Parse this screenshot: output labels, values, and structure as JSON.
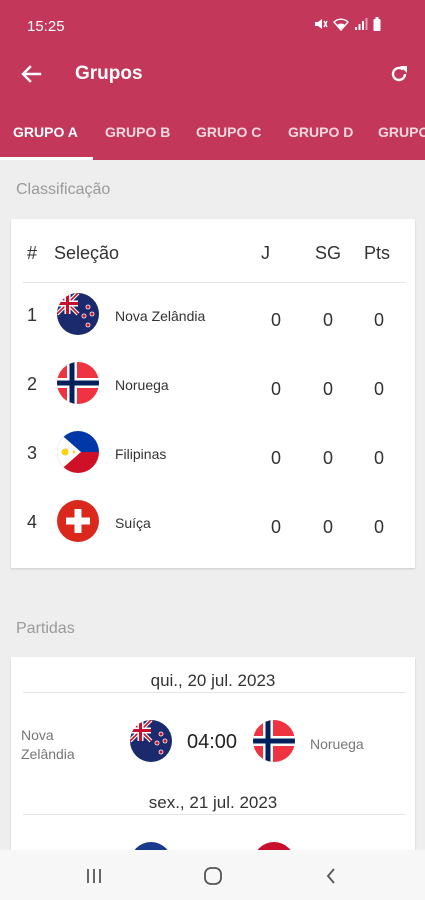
{
  "status": {
    "time": "15:25"
  },
  "toolbar": {
    "title": "Grupos"
  },
  "tabs": [
    {
      "label": "GRUPO A",
      "active": true
    },
    {
      "label": "GRUPO B",
      "active": false
    },
    {
      "label": "GRUPO C",
      "active": false
    },
    {
      "label": "GRUPO D",
      "active": false
    },
    {
      "label": "GRUPO",
      "active": false
    }
  ],
  "standings": {
    "section_title": "Classificação",
    "headers": {
      "pos": "#",
      "team": "Seleção",
      "played": "J",
      "goal_diff": "SG",
      "points": "Pts"
    },
    "rows": [
      {
        "pos": "1",
        "team": "Nova Zelândia",
        "played": "0",
        "goal_diff": "0",
        "points": "0",
        "flag": "new-zealand"
      },
      {
        "pos": "2",
        "team": "Noruega",
        "played": "0",
        "goal_diff": "0",
        "points": "0",
        "flag": "norway"
      },
      {
        "pos": "3",
        "team": "Filipinas",
        "played": "0",
        "goal_diff": "0",
        "points": "0",
        "flag": "philippines"
      },
      {
        "pos": "4",
        "team": "Suíça",
        "played": "0",
        "goal_diff": "0",
        "points": "0",
        "flag": "switzerland"
      }
    ]
  },
  "matches": {
    "section_title": "Partidas",
    "days": [
      {
        "date": "qui., 20 jul. 2023",
        "games": [
          {
            "home_line1": "Nova",
            "home_line2": "Zelândia",
            "time": "04:00",
            "away": "Noruega"
          }
        ]
      },
      {
        "date": "sex., 21 jul. 2023"
      }
    ]
  },
  "colors": {
    "primary": "#c2375a",
    "background": "#eeeeee",
    "card": "#ffffff"
  }
}
